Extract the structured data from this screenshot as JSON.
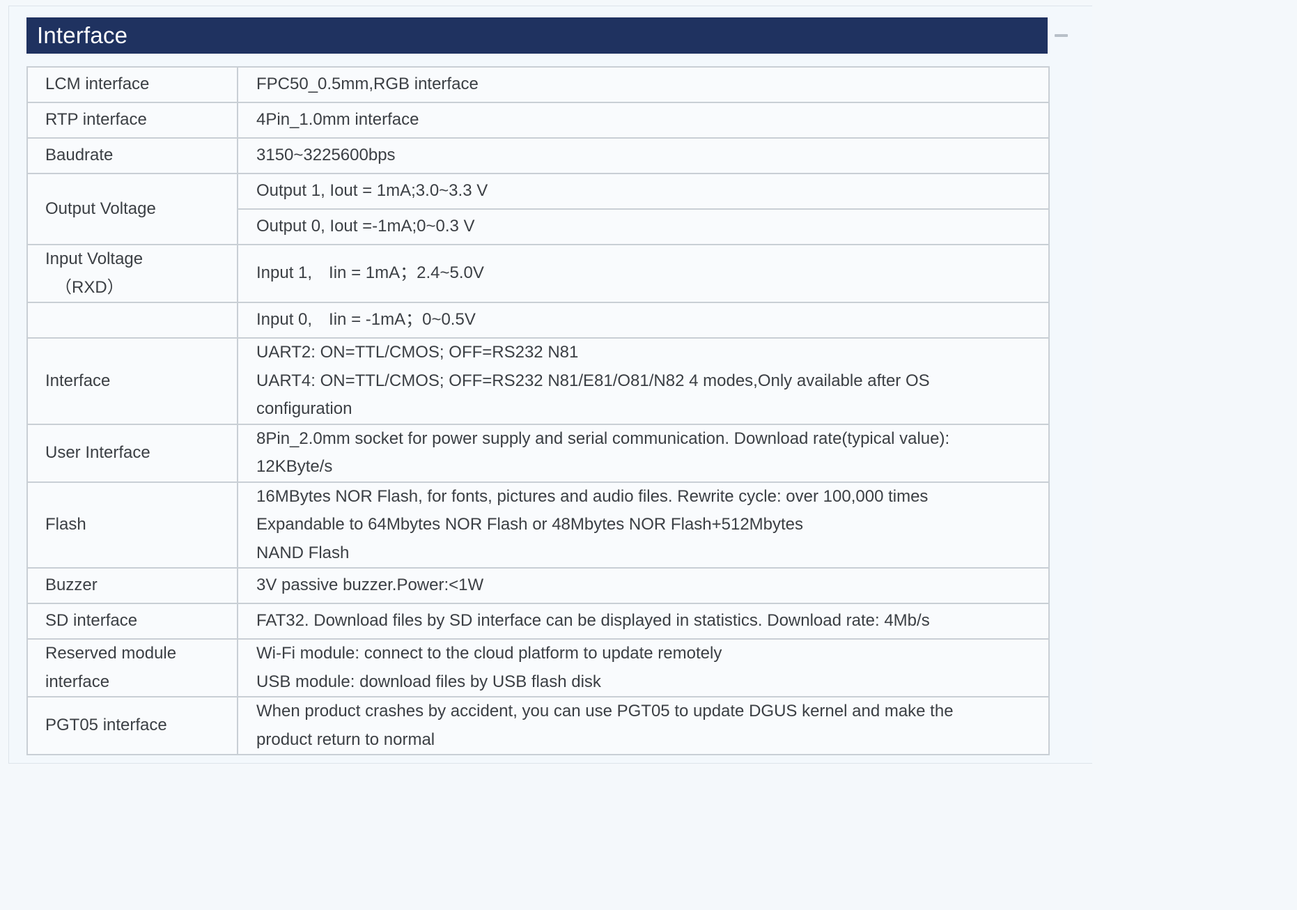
{
  "section": {
    "title": "Interface",
    "collapse_icon": "minus-icon"
  },
  "rows": [
    {
      "key": "LCM interface",
      "value": "FPC50_0.5mm,RGB interface"
    },
    {
      "key": "RTP interface",
      "value": "4Pin_1.0mm interface"
    },
    {
      "key": "Baudrate",
      "value": "3150~3225600bps"
    },
    {
      "key": "Output Voltage",
      "values": [
        "Output 1, Iout = 1mA;3.0~3.3 V",
        "Output 0, Iout =-1mA;0~0.3 V"
      ]
    },
    {
      "key": "Input Voltage",
      "key_sub": "（RXD）",
      "value": "Input 1,　Iin = 1mA；2.4~5.0V"
    },
    {
      "key": "",
      "value": "Input 0,　Iin = -1mA；0~0.5V"
    },
    {
      "key": "Interface",
      "lines": [
        "UART2: ON=TTL/CMOS; OFF=RS232 N81",
        "UART4: ON=TTL/CMOS; OFF=RS232 N81/E81/O81/N82 4 modes,Only available after OS",
        "configuration"
      ]
    },
    {
      "key": "User Interface",
      "lines": [
        "8Pin_2.0mm socket for power supply and serial communication. Download rate(typical value):",
        "12KByte/s"
      ]
    },
    {
      "key": "Flash",
      "lines": [
        "16MBytes NOR Flash, for fonts, pictures and audio files. Rewrite cycle: over 100,000 times",
        "Expandable to 64Mbytes NOR Flash or 48Mbytes NOR Flash+512Mbytes",
        "NAND Flash"
      ]
    },
    {
      "key": "Buzzer",
      "value": "3V passive buzzer.Power:<1W"
    },
    {
      "key": "SD interface",
      "value": "FAT32. Download files by SD interface can be displayed in statistics. Download rate: 4Mb/s"
    },
    {
      "key_lines": [
        "Reserved module",
        "interface"
      ],
      "lines": [
        "Wi-Fi module: connect to the cloud platform to update remotely",
        "USB module: download files by USB flash disk"
      ]
    },
    {
      "key": "PGT05 interface",
      "lines": [
        "When product crashes by accident, you can use PGT05 to update DGUS kernel and make the",
        "product return to normal"
      ]
    }
  ]
}
